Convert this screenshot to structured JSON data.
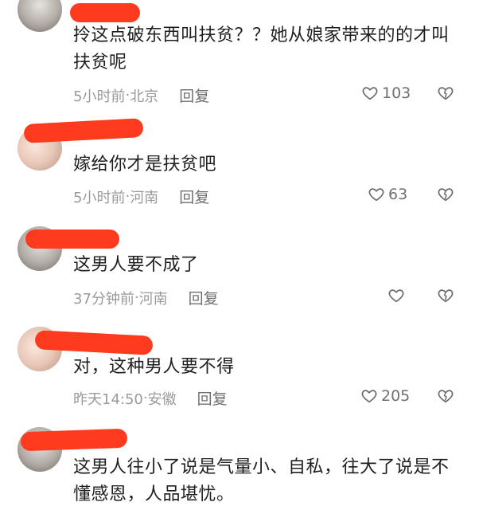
{
  "comments": [
    {
      "text": "拎这点破东西叫扶贫？？她从娘家带来的的才叫扶贫呢",
      "time": "5小时前",
      "location": "北京",
      "reply_label": "回复",
      "likes": "103"
    },
    {
      "text": "嫁给你才是扶贫吧",
      "time": "5小时前",
      "location": "河南",
      "reply_label": "回复",
      "likes": "63"
    },
    {
      "text": "这男人要不成了",
      "time": "37分钟前",
      "location": "河南",
      "reply_label": "回复",
      "likes": ""
    },
    {
      "text": "对，这种男人要不得",
      "time": "昨天14:50",
      "location": "安徽",
      "reply_label": "回复",
      "likes": "205"
    },
    {
      "text": "这男人往小了说是气量小、自私，往大了说是不懂感恩，人品堪忧。",
      "time": "",
      "location": "",
      "reply_label": "",
      "likes": ""
    }
  ],
  "separator": " · ",
  "colors": {
    "redaction": "#ff3b1f",
    "meta_text": "#9a9a9a",
    "body_text": "#1f1f1f"
  },
  "icons": {
    "like": "heart-outline-icon",
    "dislike": "broken-heart-icon"
  }
}
